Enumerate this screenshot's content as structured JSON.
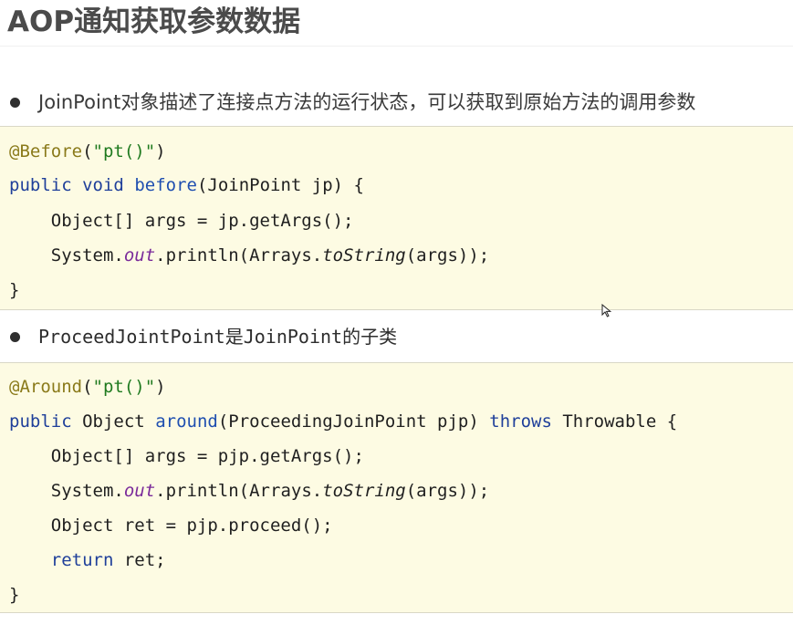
{
  "title": "AOP通知获取参数数据",
  "bullets": [
    {
      "text": "JoinPoint对象描述了连接点方法的运行状态，可以获取到原始方法的调用参数"
    },
    {
      "text": "ProceedJointPoint是JoinPoint的子类"
    }
  ],
  "code1": {
    "l1": {
      "ann": "@Before",
      "open": "(",
      "str": "\"pt()\"",
      "close": ")"
    },
    "l2": {
      "kw1": "public",
      "kw2": "void",
      "fn": "before",
      "rest": "(JoinPoint jp) {"
    },
    "l3": {
      "text": "Object[] args = jp.getArgs();"
    },
    "l4": {
      "a": "System.",
      "fld": "out",
      "b": ".println(Arrays.",
      "c": "toString",
      "d": "(args));"
    },
    "l5": {
      "text": "}"
    }
  },
  "code2": {
    "l1": {
      "ann": "@Around",
      "open": "(",
      "str": "\"pt()\"",
      "close": ")"
    },
    "l2": {
      "kw1": "public",
      "t1": "Object",
      "fn": "around",
      "params": "(ProceedingJoinPoint pjp)",
      "kw2": "throws",
      "rest": "Throwable {"
    },
    "l3": {
      "text": "Object[] args = pjp.getArgs();"
    },
    "l4": {
      "a": "System.",
      "fld": "out",
      "b": ".println(Arrays.",
      "c": "toString",
      "d": "(args));"
    },
    "l5": {
      "text": "Object ret = pjp.proceed();"
    },
    "l6": {
      "kw": "return",
      "rest": "ret;"
    },
    "l7": {
      "text": "}"
    }
  },
  "icons": {
    "bullet": "bullet-dot-icon",
    "cursor": "mouse-cursor-icon"
  }
}
